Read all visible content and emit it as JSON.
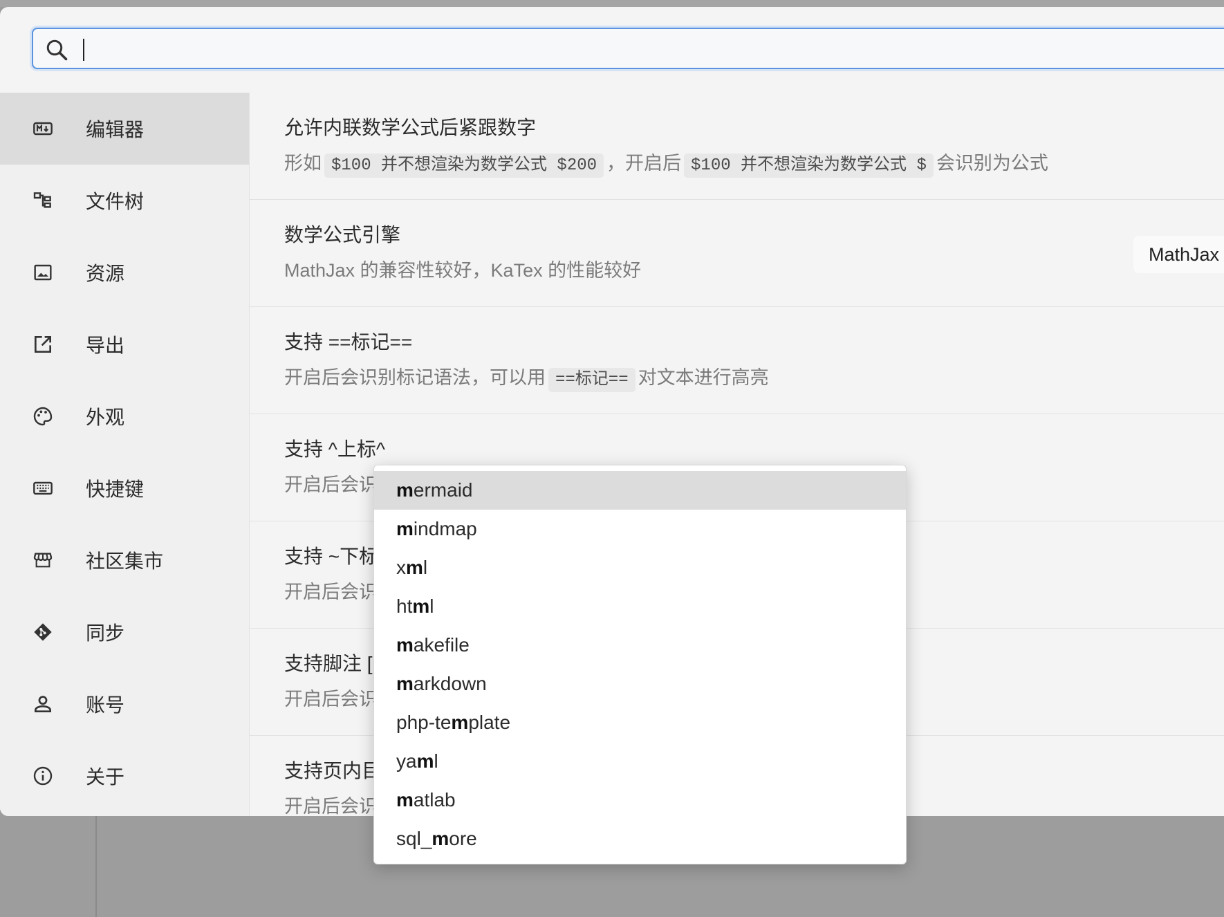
{
  "search": {
    "value": "",
    "placeholder": ""
  },
  "sidebar": {
    "items": [
      {
        "label": "编辑器",
        "icon": "markdown-icon",
        "active": true
      },
      {
        "label": "文件树",
        "icon": "file-tree-icon"
      },
      {
        "label": "资源",
        "icon": "image-icon"
      },
      {
        "label": "导出",
        "icon": "export-icon"
      },
      {
        "label": "外观",
        "icon": "palette-icon"
      },
      {
        "label": "快捷键",
        "icon": "keyboard-icon"
      },
      {
        "label": "社区集市",
        "icon": "store-icon"
      },
      {
        "label": "同步",
        "icon": "git-icon"
      },
      {
        "label": "账号",
        "icon": "user-icon"
      },
      {
        "label": "关于",
        "icon": "info-icon"
      }
    ]
  },
  "settings": {
    "inline_math": {
      "title": "允许内联数学公式后紧跟数字",
      "desc_prefix": "形如",
      "code1": "$100 并不想渲染为数学公式 $200",
      "desc_mid": "，开启后",
      "code2": "$100 并不想渲染为数学公式 $",
      "desc_suffix": "会识别为公式"
    },
    "math_engine": {
      "title": "数学公式引擎",
      "desc": "MathJax 的兼容性较好，KaTex 的性能较好",
      "value": "MathJax"
    },
    "mark": {
      "title": "支持 ==标记==",
      "desc_prefix": "开启后会识别标记语法，可以用",
      "code": "==标记==",
      "desc_suffix": "对文本进行高亮"
    },
    "sup": {
      "title": "支持 ^上标^",
      "desc": "开启后会识"
    },
    "sub": {
      "title": "支持 ~下标",
      "desc": "开启后会识"
    },
    "footnote": {
      "title": "支持脚注 [",
      "desc": "开启后会识"
    },
    "toc": {
      "title": "支持页内目",
      "desc": "开启后会识"
    }
  },
  "dropdown": {
    "items": [
      {
        "pre": "",
        "match": "m",
        "post": "ermaid"
      },
      {
        "pre": "",
        "match": "m",
        "post": "indmap"
      },
      {
        "pre": "x",
        "match": "m",
        "post": "l"
      },
      {
        "pre": "ht",
        "match": "m",
        "post": "l"
      },
      {
        "pre": "",
        "match": "m",
        "post": "akefile"
      },
      {
        "pre": "",
        "match": "m",
        "post": "arkdown"
      },
      {
        "pre": "php-te",
        "match": "m",
        "post": "plate"
      },
      {
        "pre": "ya",
        "match": "m",
        "post": "l"
      },
      {
        "pre": "",
        "match": "m",
        "post": "atlab"
      },
      {
        "pre": "sql_",
        "match": "m",
        "post": "ore"
      }
    ]
  },
  "colors": {
    "accent": "#5b93de",
    "active_bg": "#dcdcdc",
    "panel_bg": "#f4f4f4"
  }
}
